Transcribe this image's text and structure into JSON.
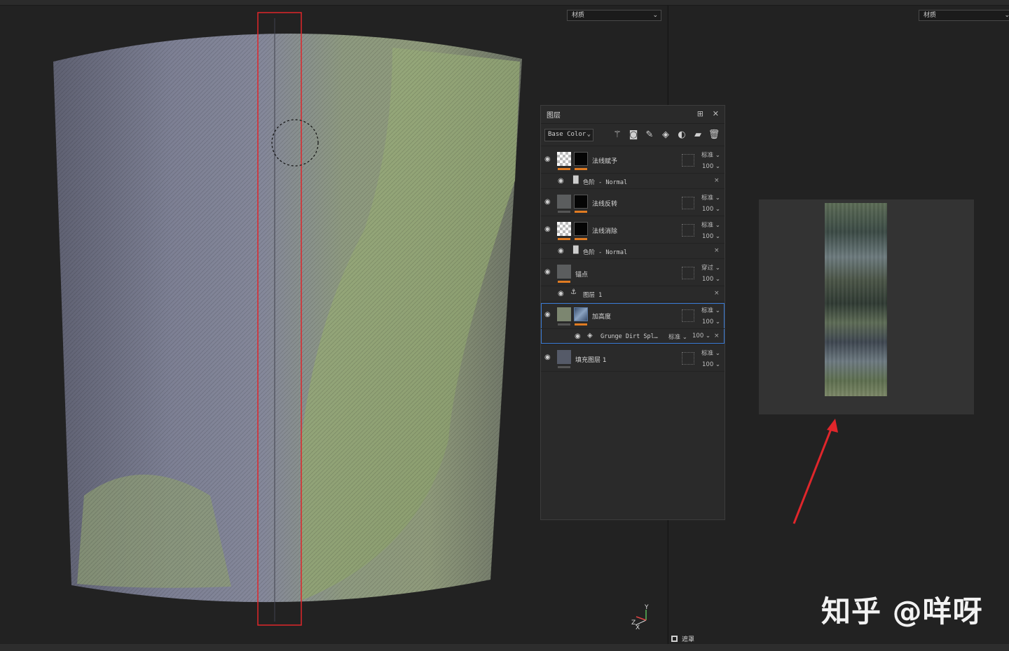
{
  "viewports": {
    "left_select": "材质",
    "right_select": "材质"
  },
  "layers_panel": {
    "title": "图层",
    "channel": "Base Color",
    "header_icons": [
      "dock-icon",
      "close-icon"
    ],
    "tool_icons": [
      "magic-wand-icon",
      "add-mask-icon",
      "paint-brush-icon",
      "fill-bucket-icon",
      "smart-material-icon",
      "folder-icon",
      "trash-icon"
    ],
    "layers": [
      {
        "name": "法线赋予",
        "blend": "标准",
        "opacity": "100"
      },
      {
        "name": "法线反转",
        "blend": "标准",
        "opacity": "100"
      },
      {
        "name": "法线消除",
        "blend": "标准",
        "opacity": "100"
      },
      {
        "name": "锚点",
        "blend": "穿过",
        "opacity": "100"
      },
      {
        "name": "加高度",
        "blend": "标准",
        "opacity": "100"
      },
      {
        "name": "填充图层 1",
        "blend": "标准",
        "opacity": "100"
      }
    ],
    "sub_rows": [
      {
        "text": "色阶 - Normal"
      },
      {
        "text": "色阶 - Normal"
      },
      {
        "text": "图层 1"
      },
      {
        "text": "Grunge Dirt Spl…",
        "blend": "标准",
        "opacity": "100"
      }
    ]
  },
  "bottom": {
    "mask_label": "遮罩"
  },
  "axis": {
    "y": "Y",
    "z": "Z",
    "x": "X"
  },
  "watermark": "知乎 @咩呀",
  "colors": {
    "accent_orange": "#e07b22",
    "selection_blue": "#3a7bd5",
    "annotation_red": "#e0262b"
  }
}
